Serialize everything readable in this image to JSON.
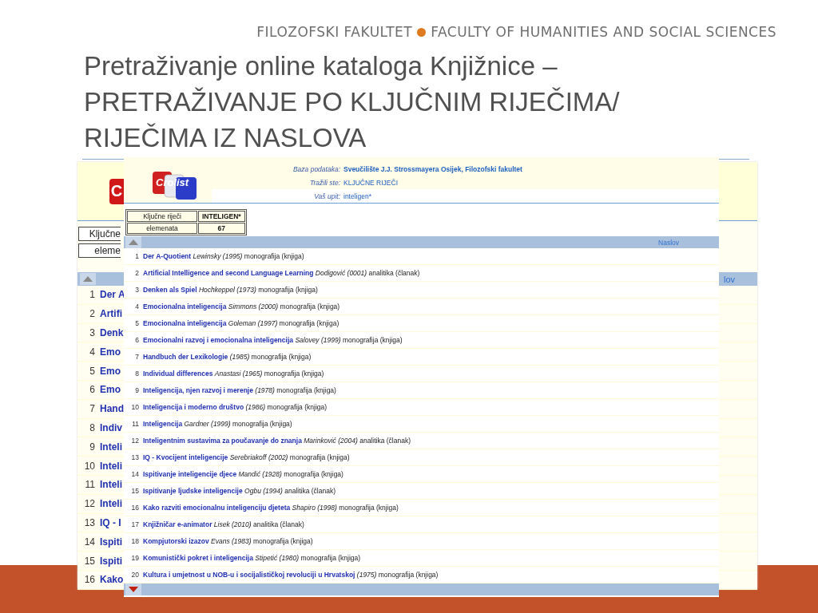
{
  "header": {
    "left": "FILOZOFSKI FAKULTET",
    "right": "FACULTY OF HUMANITIES AND SOCIAL SCIENCES"
  },
  "title_lines": [
    "Pretraživanje online kataloga Knjižnice –",
    "PRETRAŽIVANJE PO KLJUČNIM RIJEČIMA/",
    "RIJEČIMA IZ NASLOVA"
  ],
  "back_screenshot": {
    "logo_text": "C",
    "summary": [
      "Ključne",
      "eleme"
    ],
    "column_header": "lov",
    "rows": [
      {
        "number": "1",
        "title": "Der A"
      },
      {
        "number": "2",
        "title": "Artifi"
      },
      {
        "number": "3",
        "title": "Denk"
      },
      {
        "number": "4",
        "title": "Emo"
      },
      {
        "number": "5",
        "title": "Emo"
      },
      {
        "number": "6",
        "title": "Emo"
      },
      {
        "number": "7",
        "title": "Hand"
      },
      {
        "number": "8",
        "title": "Indiv"
      },
      {
        "number": "9",
        "title": "Inteli"
      },
      {
        "number": "10",
        "title": "Inteli"
      },
      {
        "number": "11",
        "title": "Inteli"
      },
      {
        "number": "12",
        "title": "Inteli"
      },
      {
        "number": "13",
        "title": "IQ - I"
      },
      {
        "number": "14",
        "title": "Ispiti"
      },
      {
        "number": "15",
        "title": "Ispiti"
      },
      {
        "number": "16",
        "title": "Kako"
      }
    ]
  },
  "front_screenshot": {
    "logo_text": "Crolist",
    "fields": [
      {
        "label": "Baza podataka:",
        "value": "Sveučilište J.J. Strossmayera Osijek, Filozofski fakultet",
        "bold": true
      },
      {
        "label": "Tražili ste:",
        "value": "KLJUČNE RIJEČI",
        "bold": false
      },
      {
        "label": "Vaš upit:",
        "value": "inteligen*",
        "bold": false
      }
    ],
    "summary": [
      {
        "label": "Ključne riječi",
        "value": "INTELIGEN*"
      },
      {
        "label": "elemenata",
        "value": "67"
      }
    ],
    "column_header": "Naslov",
    "rows": [
      {
        "number": "1",
        "title": "Der A-Quotient",
        "author": "Lewinsky",
        "year": "(1995)",
        "type": "monografija (knjiga)"
      },
      {
        "number": "2",
        "title": "Artificial Intelligence and second Language Learning",
        "author": "Dodigović",
        "year": "(0001)",
        "type": "analitika (članak)"
      },
      {
        "number": "3",
        "title": "Denken als Spiel",
        "author": "Hochkeppel",
        "year": "(1973)",
        "type": "monografija (knjiga)"
      },
      {
        "number": "4",
        "title": "Emocionalna inteligencija",
        "author": "Simmons",
        "year": "(2000)",
        "type": "monografija (knjiga)"
      },
      {
        "number": "5",
        "title": "Emocionalna inteligencija",
        "author": "Goleman",
        "year": "(1997)",
        "type": "monografija (knjiga)"
      },
      {
        "number": "6",
        "title": "Emocionalni razvoj i emocionalna inteligencija",
        "author": "Salovey",
        "year": "(1999)",
        "type": "monografija (knjiga)"
      },
      {
        "number": "7",
        "title": "Handbuch der Lexikologie",
        "year": "(1985)",
        "type": "monografija (knjiga)"
      },
      {
        "number": "8",
        "title": "Individual differences",
        "author": "Anastasi",
        "year": "(1965)",
        "type": "monografija (knjiga)"
      },
      {
        "number": "9",
        "title": "Inteligencija, njen razvoj i merenje",
        "year": "(1978)",
        "type": "monografija (knjiga)"
      },
      {
        "number": "10",
        "title": "Inteligencija i moderno društvo",
        "year": "(1986)",
        "type": "monografija (knjiga)"
      },
      {
        "number": "11",
        "title": "Inteligencija",
        "author": "Gardner",
        "year": "(1999)",
        "type": "monografija (knjiga)"
      },
      {
        "number": "12",
        "title": "Inteligentnim sustavima za poučavanje do znanja",
        "author": "Marinković",
        "year": "(2004)",
        "type": "analitika (članak)"
      },
      {
        "number": "13",
        "title": "IQ - Kvocijent inteligencije",
        "author": "Serebriakoff",
        "year": "(2002)",
        "type": "monografija (knjiga)"
      },
      {
        "number": "14",
        "title": "Ispitivanje inteligencije djece",
        "author": "Mandić",
        "year": "(1928)",
        "type": "monografija (knjiga)"
      },
      {
        "number": "15",
        "title": "Ispitivanje ljudske inteligencije",
        "author": "Ogbu",
        "year": "(1994)",
        "type": "analitika (članak)"
      },
      {
        "number": "16",
        "title": "Kako razviti emocionalnu inteligenciju djeteta",
        "author": "Shapiro",
        "year": "(1998)",
        "type": "monografija (knjiga)"
      },
      {
        "number": "17",
        "title": "Knjižničar e-animator",
        "author": "Lisek",
        "year": "(2010)",
        "type": "analitika (članak)"
      },
      {
        "number": "18",
        "title": "Kompjutorski izazov",
        "author": "Evans",
        "year": "(1983)",
        "type": "monografija (knjiga)"
      },
      {
        "number": "19",
        "title": "Komunistički pokret i inteligencija",
        "author": "Stipetić",
        "year": "(1980)",
        "type": "monografija (knjiga)"
      },
      {
        "number": "20",
        "title": "Kultura i umjetnost u NOB-u i socijalističkoj revoluciji u Hrvatskoj",
        "year": "(1975)",
        "type": "monografija (knjiga)"
      }
    ]
  }
}
